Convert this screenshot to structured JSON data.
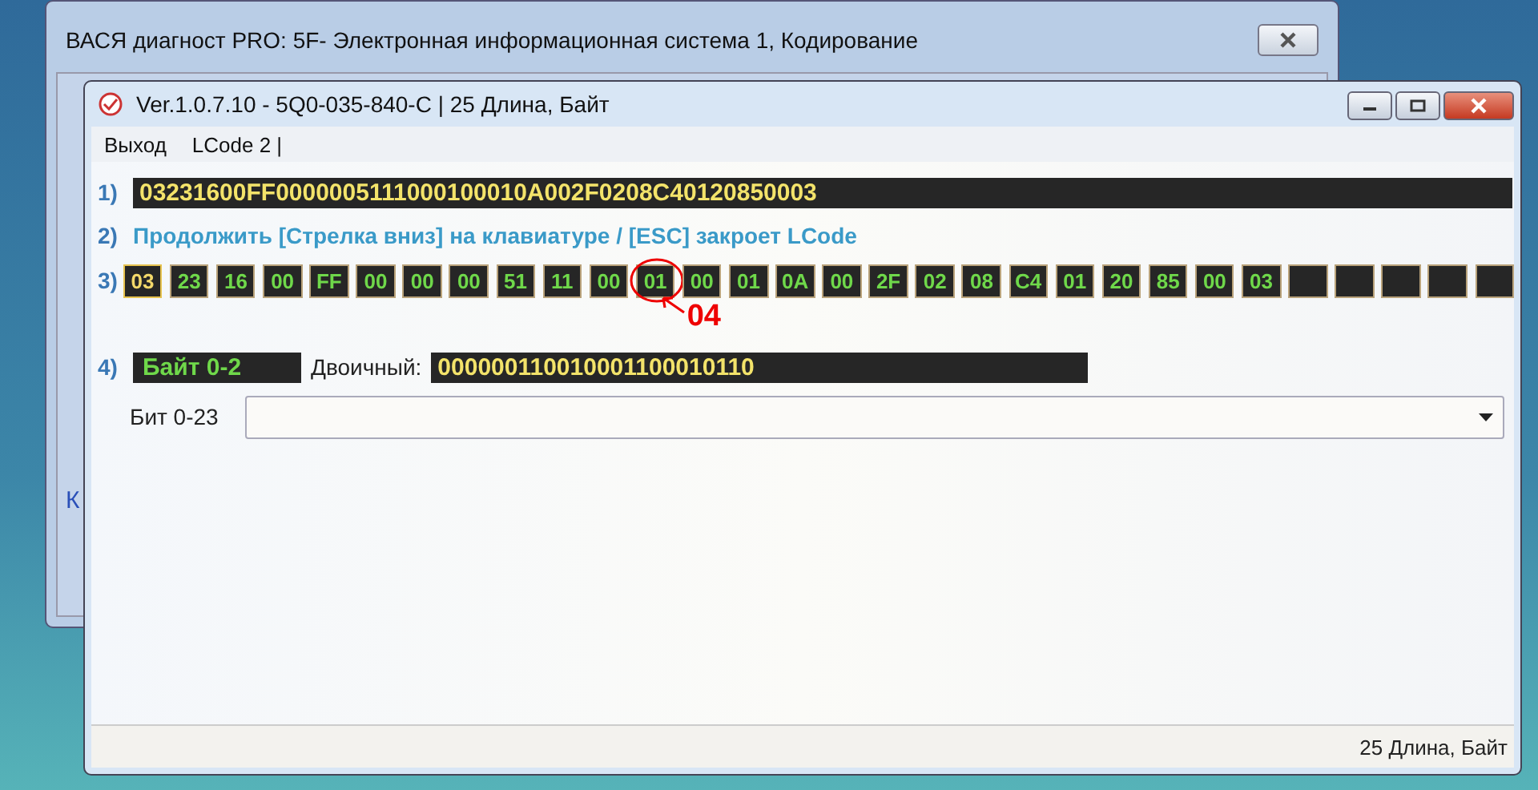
{
  "back_window": {
    "title": "ВАСЯ диагност PRO: 5F- Электронная информационная система 1,  Кодирование",
    "edge_text": "К"
  },
  "window": {
    "title": "Ver.1.0.7.10 -   5Q0-035-840-C | 25 Длина, Байт"
  },
  "menu": [
    "Выход",
    "LCode 2 |"
  ],
  "row1": {
    "label": "1)",
    "value": "03231600FF0000005111000100010A002F0208C40120850003"
  },
  "row2": {
    "label": "2)",
    "text": "Продолжить [Стрелка вниз] на клавиатуре / [ESC] закроет LCode"
  },
  "row3": {
    "label": "3)",
    "bytes": [
      {
        "value": "03",
        "selected": true,
        "annotated": false
      },
      {
        "value": "23",
        "selected": false,
        "annotated": false
      },
      {
        "value": "16",
        "selected": false,
        "annotated": false
      },
      {
        "value": "00",
        "selected": false,
        "annotated": false
      },
      {
        "value": "FF",
        "selected": false,
        "annotated": false
      },
      {
        "value": "00",
        "selected": false,
        "annotated": false
      },
      {
        "value": "00",
        "selected": false,
        "annotated": false
      },
      {
        "value": "00",
        "selected": false,
        "annotated": false
      },
      {
        "value": "51",
        "selected": false,
        "annotated": false
      },
      {
        "value": "11",
        "selected": false,
        "annotated": false
      },
      {
        "value": "00",
        "selected": false,
        "annotated": false
      },
      {
        "value": "01",
        "selected": false,
        "annotated": true
      },
      {
        "value": "00",
        "selected": false,
        "annotated": false
      },
      {
        "value": "01",
        "selected": false,
        "annotated": false
      },
      {
        "value": "0A",
        "selected": false,
        "annotated": false
      },
      {
        "value": "00",
        "selected": false,
        "annotated": false
      },
      {
        "value": "2F",
        "selected": false,
        "annotated": false
      },
      {
        "value": "02",
        "selected": false,
        "annotated": false
      },
      {
        "value": "08",
        "selected": false,
        "annotated": false
      },
      {
        "value": "C4",
        "selected": false,
        "annotated": false
      },
      {
        "value": "01",
        "selected": false,
        "annotated": false
      },
      {
        "value": "20",
        "selected": false,
        "annotated": false
      },
      {
        "value": "85",
        "selected": false,
        "annotated": false
      },
      {
        "value": "00",
        "selected": false,
        "annotated": false
      },
      {
        "value": "03",
        "selected": false,
        "annotated": false
      },
      {
        "selected": false,
        "annotated": false
      },
      {
        "selected": false,
        "annotated": false
      },
      {
        "selected": false,
        "annotated": false
      },
      {
        "selected": false,
        "annotated": false
      },
      {
        "selected": false,
        "annotated": false
      }
    ],
    "annotation": "04"
  },
  "row4": {
    "label": "4)",
    "byte_label": "Байт 0-2",
    "binary_label": "Двоичный:",
    "binary": "000000110010001100010110"
  },
  "bit_select": {
    "label": "Бит 0-23"
  },
  "status_bar": "25 Длина, Байт"
}
